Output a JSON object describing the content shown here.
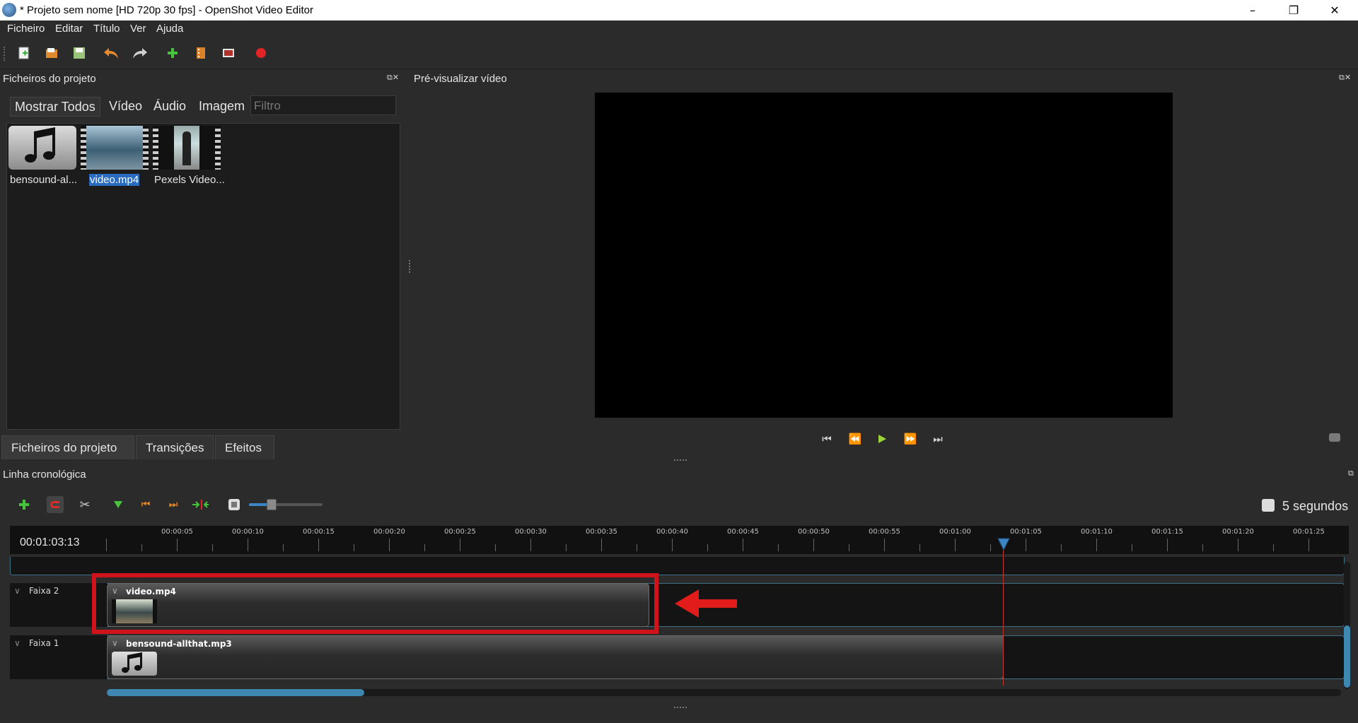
{
  "window": {
    "title": "* Projeto sem nome [HD 720p 30 fps] - OpenShot Video Editor",
    "minimize": "–",
    "restore": "❐",
    "close": "✕"
  },
  "menu": [
    "Ficheiro",
    "Editar",
    "Título",
    "Ver",
    "Ajuda"
  ],
  "toolbar_icons": [
    "new-project-icon",
    "open-project-icon",
    "save-project-icon",
    "undo-icon",
    "redo-icon",
    "import-files-icon",
    "choose-profile-icon",
    "fullscreen-icon",
    "export-video-icon"
  ],
  "project_files": {
    "title": "Ficheiros do projeto",
    "tabs": [
      "Mostrar Todos",
      "Vídeo",
      "Áudio",
      "Imagem"
    ],
    "filter_placeholder": "Filtro",
    "items": [
      {
        "label": "bensound-al...",
        "type": "audio"
      },
      {
        "label": "video.mp4",
        "type": "video",
        "selected": true
      },
      {
        "label": "Pexels Video...",
        "type": "video"
      }
    ]
  },
  "bottom_tabs": [
    "Ficheiros do projeto",
    "Transições",
    "Efeitos"
  ],
  "preview": {
    "title": "Pré-visualizar vídeo"
  },
  "timeline": {
    "title": "Linha cronológica",
    "current_time": "00:01:03:13",
    "zoom_label": "5 segundos",
    "zoom_level": 0.3,
    "ruler_labels": [
      "00:00:05",
      "00:00:10",
      "00:00:15",
      "00:00:20",
      "00:00:25",
      "00:00:30",
      "00:00:35",
      "00:00:40",
      "00:00:45",
      "00:00:50",
      "00:00:55",
      "00:01:00",
      "00:01:05",
      "00:01:10",
      "00:01:15",
      "00:01:20",
      "00:01:25"
    ],
    "tracks": [
      {
        "name": "Faixa 2",
        "clip": "video.mp4"
      },
      {
        "name": "Faixa 1",
        "clip": "bensound-allthat.mp3"
      }
    ]
  },
  "colors": {
    "accent": "#3d86c6",
    "highlight_box": "#d0121b",
    "playhead": "#c0392b"
  }
}
